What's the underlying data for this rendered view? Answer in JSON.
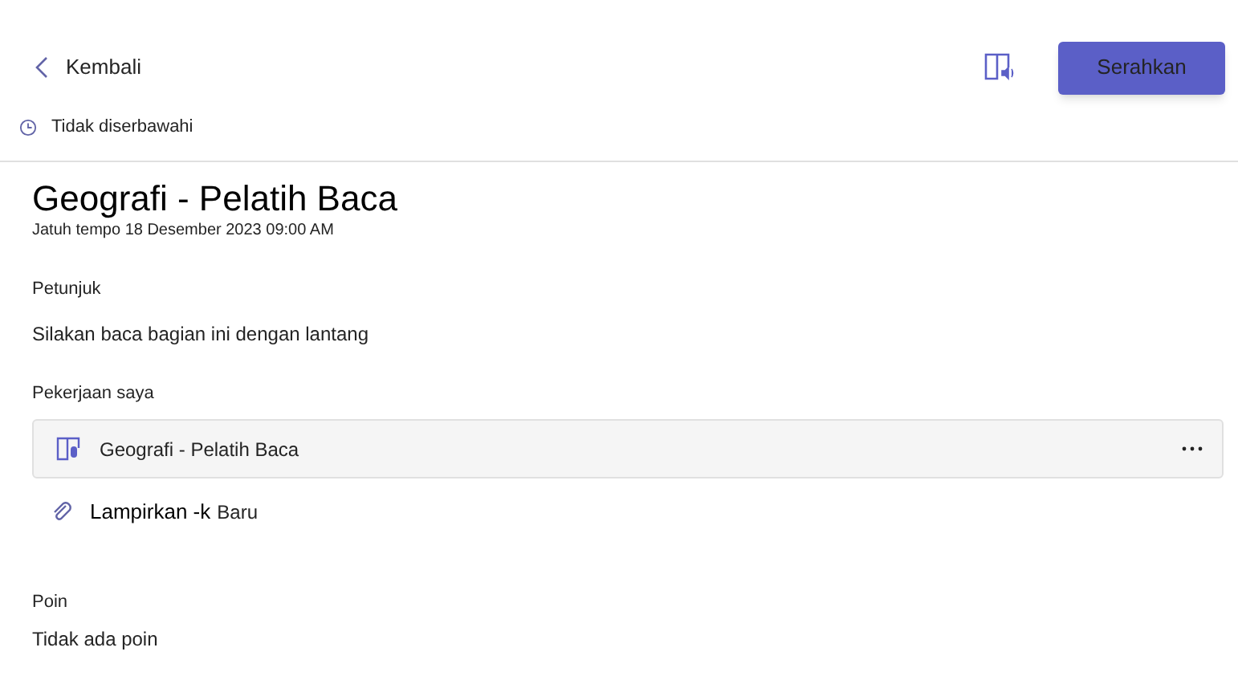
{
  "header": {
    "back_label": "Kembali",
    "submit_label": "Serahkan"
  },
  "status": "Tidak diserbawahi",
  "assignment": {
    "title": "Geografi - Pelatih Baca",
    "due": "Jatuh tempo 18 Desember 2023 09:00 AM"
  },
  "instructions": {
    "heading": "Petunjuk",
    "text": "Silakan baca bagian ini dengan lantang"
  },
  "my_work": {
    "heading": "Pekerjaan saya",
    "items": [
      {
        "title": "Geografi - Pelatih Baca"
      }
    ],
    "attach_label": "Lampirkan -k",
    "attach_new": "Baru"
  },
  "points": {
    "heading": "Poin",
    "text": "Tidak ada poin"
  }
}
